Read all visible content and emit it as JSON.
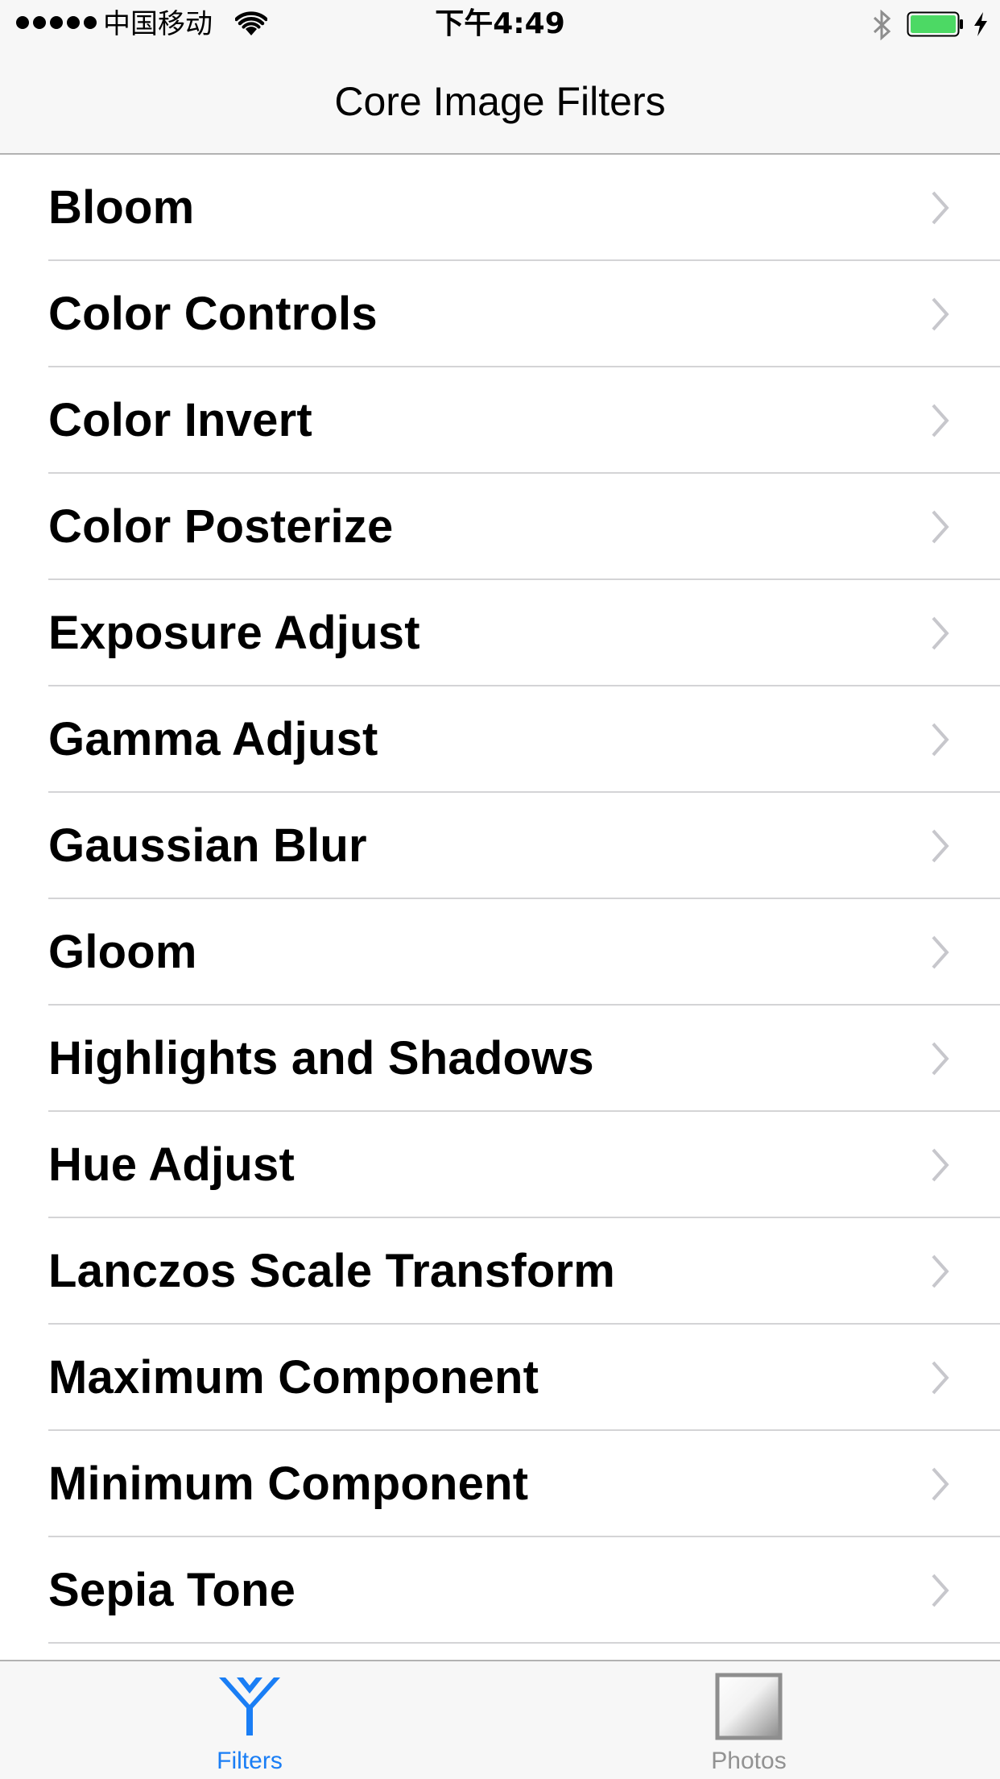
{
  "status_bar": {
    "carrier": "中国移动",
    "time": "下午4:49",
    "signal_bars": 5,
    "battery_color": "#4cd964"
  },
  "nav": {
    "title": "Core Image Filters"
  },
  "filters": [
    "Bloom",
    "Color Controls",
    "Color Invert",
    "Color Posterize",
    "Exposure Adjust",
    "Gamma Adjust",
    "Gaussian Blur",
    "Gloom",
    "Highlights and Shadows",
    "Hue Adjust",
    "Lanczos Scale Transform",
    "Maximum Component",
    "Minimum Component",
    "Sepia Tone"
  ],
  "tabbar": {
    "tabs": [
      {
        "label": "Filters",
        "icon": "filter-funnel-icon",
        "selected": true
      },
      {
        "label": "Photos",
        "icon": "photo-frame-icon",
        "selected": false
      }
    ],
    "accent_color": "#1a7ef5",
    "inactive_color": "#929292"
  }
}
